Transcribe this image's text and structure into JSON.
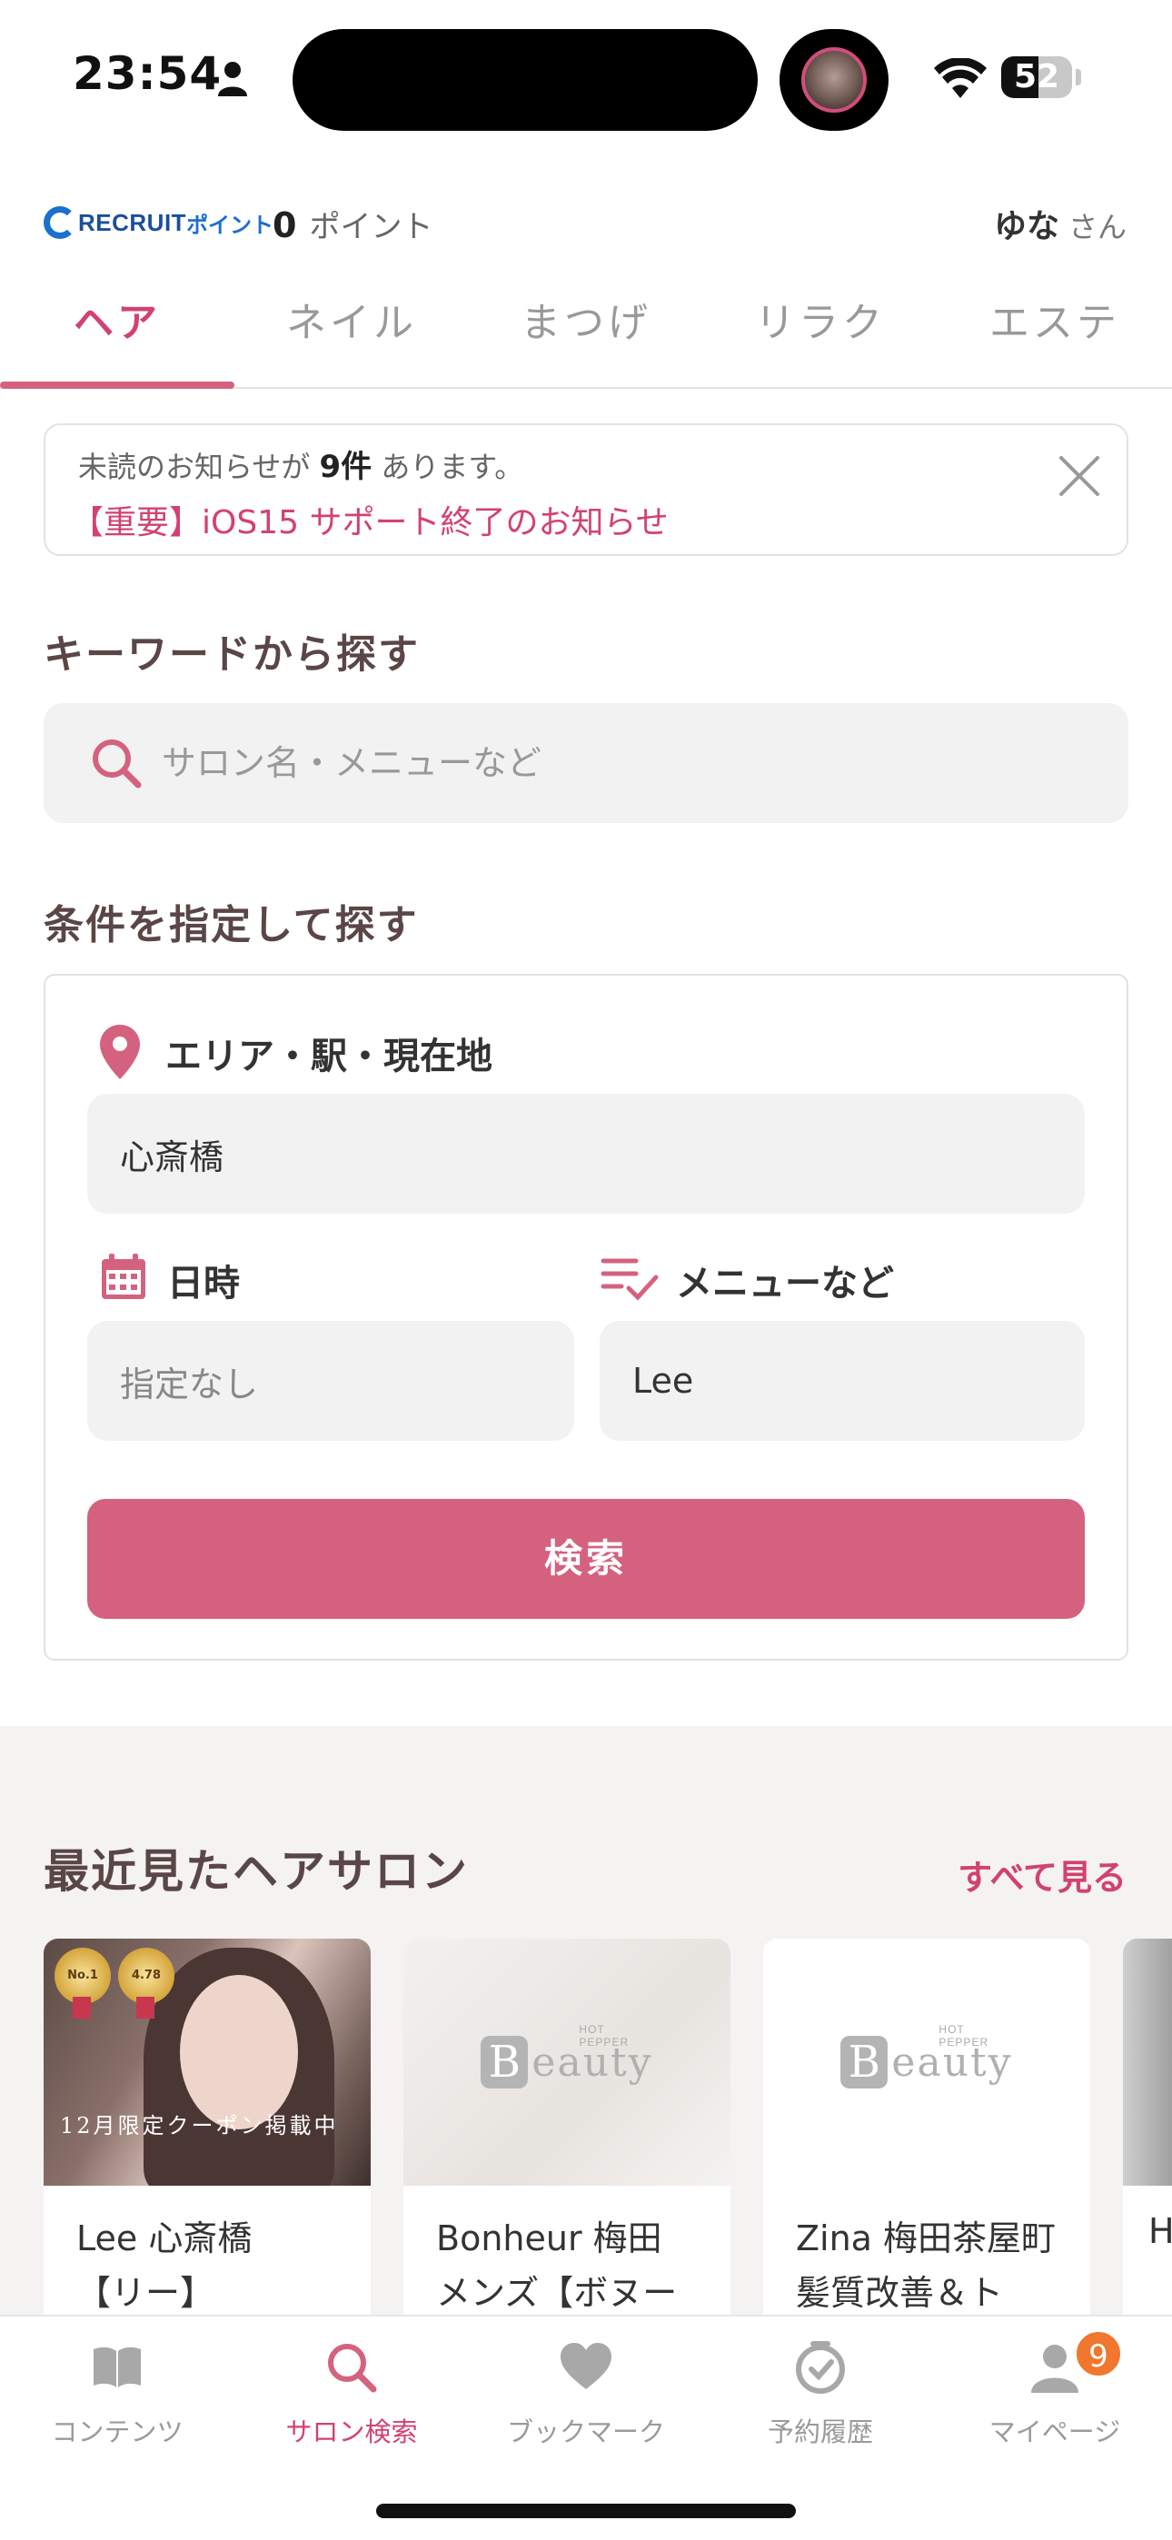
{
  "status_bar": {
    "time": "23:54",
    "battery": "52",
    "battery_level": 0.52
  },
  "header": {
    "logo_text": "RECRUIT",
    "logo_sub": "ポイント",
    "points_value": "0",
    "points_label": "ポイント",
    "user_name": "ゆな",
    "user_suffix": "さん"
  },
  "tabs": [
    {
      "label": "ヘア"
    },
    {
      "label": "ネイル"
    },
    {
      "label": "まつげ"
    },
    {
      "label": "リラク"
    },
    {
      "label": "エステ"
    }
  ],
  "notice": {
    "prefix": "未読のお知らせが",
    "count": "9件",
    "suffix": "あります。",
    "headline": "【重要】iOS15 サポート終了のお知らせ"
  },
  "keyword": {
    "heading": "キーワードから探す",
    "placeholder": "サロン名・メニューなど"
  },
  "conditions": {
    "heading": "条件を指定して探す",
    "area_label": "エリア・駅・現在地",
    "area_value": "心斎橋",
    "date_label": "日時",
    "date_value": "指定なし",
    "menu_label": "メニューなど",
    "menu_value": "Lee",
    "search_button": "検索"
  },
  "recent": {
    "title": "最近見たヘアサロン",
    "see_all": "すべて見る",
    "salons": [
      {
        "name_line1": "Lee 心斎橋",
        "name_line2": "【リー】",
        "medal1": "No.1",
        "medal2": "4.78",
        "coupon": "12月限定クーポン掲載中"
      },
      {
        "name_line1": "Bonheur 梅田",
        "name_line2": "メンズ【ボヌー"
      },
      {
        "name_line1": "Zina 梅田茶屋町",
        "name_line2": "髪質改善＆ト"
      },
      {
        "name_line1": "H",
        "name_line2": ""
      }
    ],
    "placeholder_logo_small": "HOT PEPPER",
    "placeholder_logo_B": "B",
    "placeholder_logo_rest": "eauty"
  },
  "tabbar": [
    {
      "label": "コンテンツ",
      "icon": "book-icon"
    },
    {
      "label": "サロン検索",
      "icon": "search-icon"
    },
    {
      "label": "ブックマーク",
      "icon": "heart-icon"
    },
    {
      "label": "予約履歴",
      "icon": "history-icon"
    },
    {
      "label": "マイページ",
      "icon": "person-icon",
      "badge": "9"
    }
  ],
  "colors": {
    "accent": "#d2426f",
    "button": "#d4627f",
    "badge": "#f0772d"
  }
}
